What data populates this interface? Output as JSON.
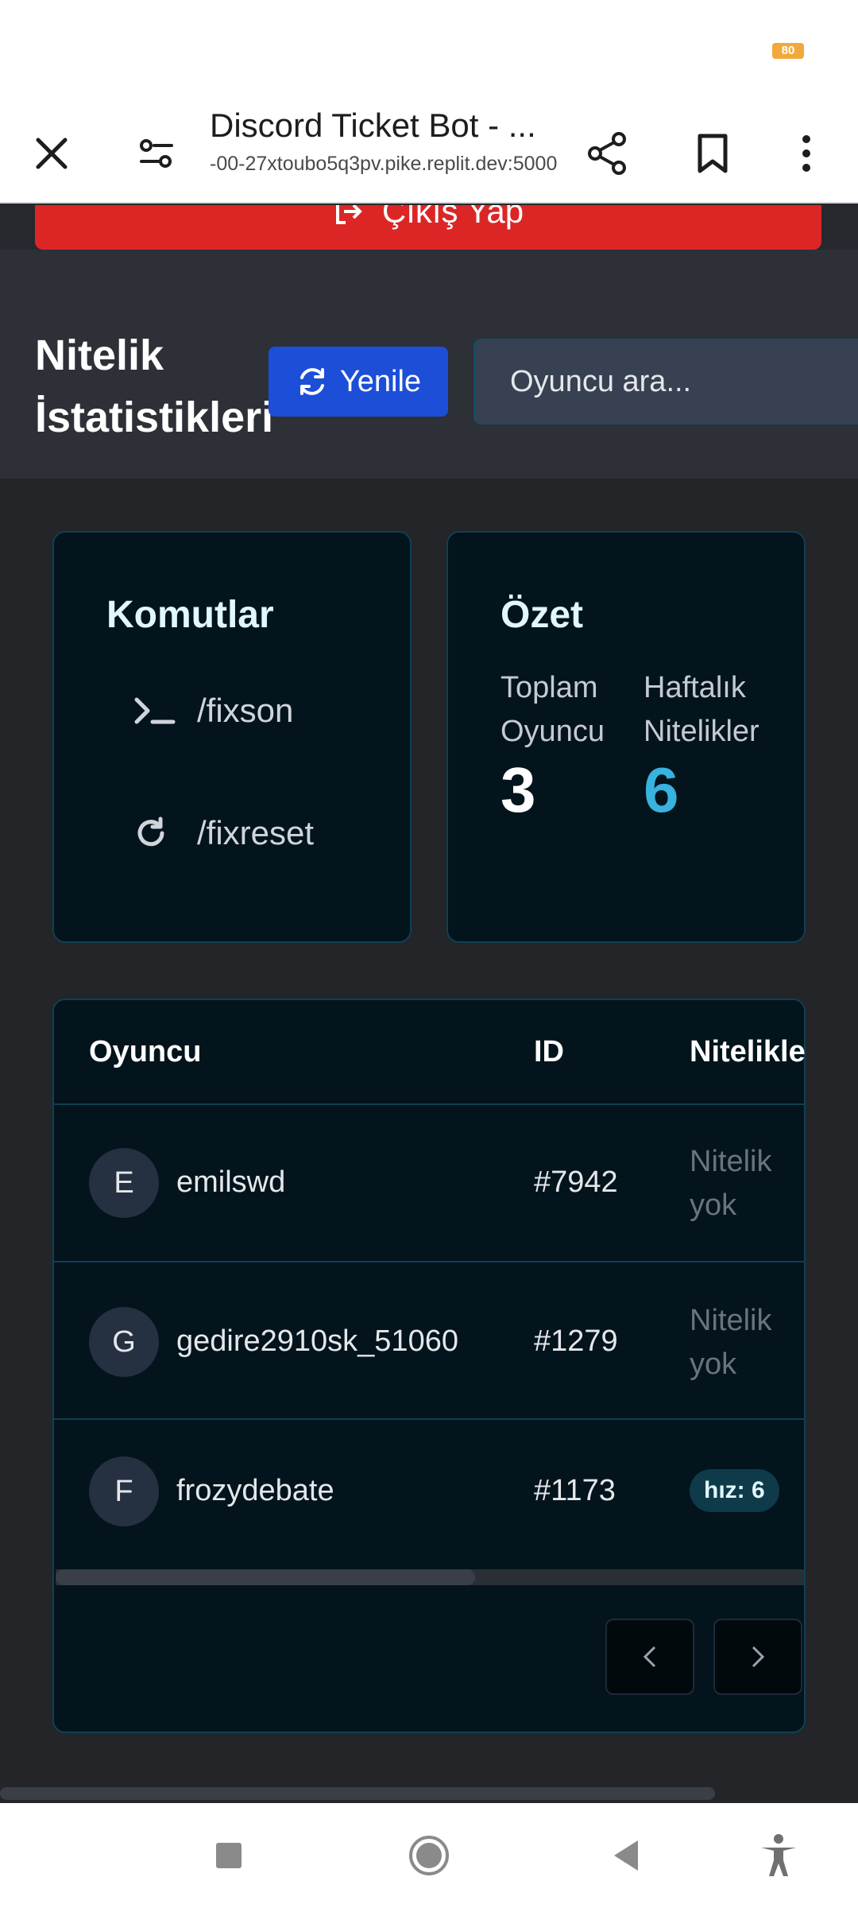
{
  "status": {
    "battery": "80"
  },
  "browser": {
    "title": "Discord Ticket Bot - ...",
    "url": "-00-27xtoubo5q3pv.pike.replit.dev:5000"
  },
  "page": {
    "logout_label": "Çıkış Yap",
    "title_line1": "Nitelik",
    "title_line2": "İstatistikleri",
    "refresh_label": "Yenile",
    "search_placeholder": "Oyuncu ara..."
  },
  "commands": {
    "title": "Komutlar",
    "items": [
      {
        "icon": "terminal-icon",
        "label": "/fixson"
      },
      {
        "icon": "refresh-icon",
        "label": "/fixreset"
      }
    ]
  },
  "summary": {
    "title": "Özet",
    "total_label_1": "Toplam",
    "total_label_2": "Oyuncu",
    "total_value": "3",
    "weekly_label_1": "Haftalık",
    "weekly_label_2": "Nitelikler",
    "weekly_value": "6",
    "weekly_color": "#38b2df"
  },
  "table": {
    "headers": {
      "player": "Oyuncu",
      "id": "ID",
      "attributes": "Nitelikle"
    },
    "rows": [
      {
        "initial": "E",
        "name": "emilswd",
        "id": "#7942",
        "attr_line1": "Nitelik",
        "attr_line2": "yok"
      },
      {
        "initial": "G",
        "name": "gedire2910sk_51060",
        "id": "#1279",
        "attr_line1": "Nitelik",
        "attr_line2": "yok"
      },
      {
        "initial": "F",
        "name": "frozydebate",
        "id": "#1173",
        "badge": "hız: 6"
      }
    ]
  },
  "colors": {
    "accent": "#1d4ed8",
    "danger": "#dc2626",
    "card_border": "#0f4052"
  }
}
